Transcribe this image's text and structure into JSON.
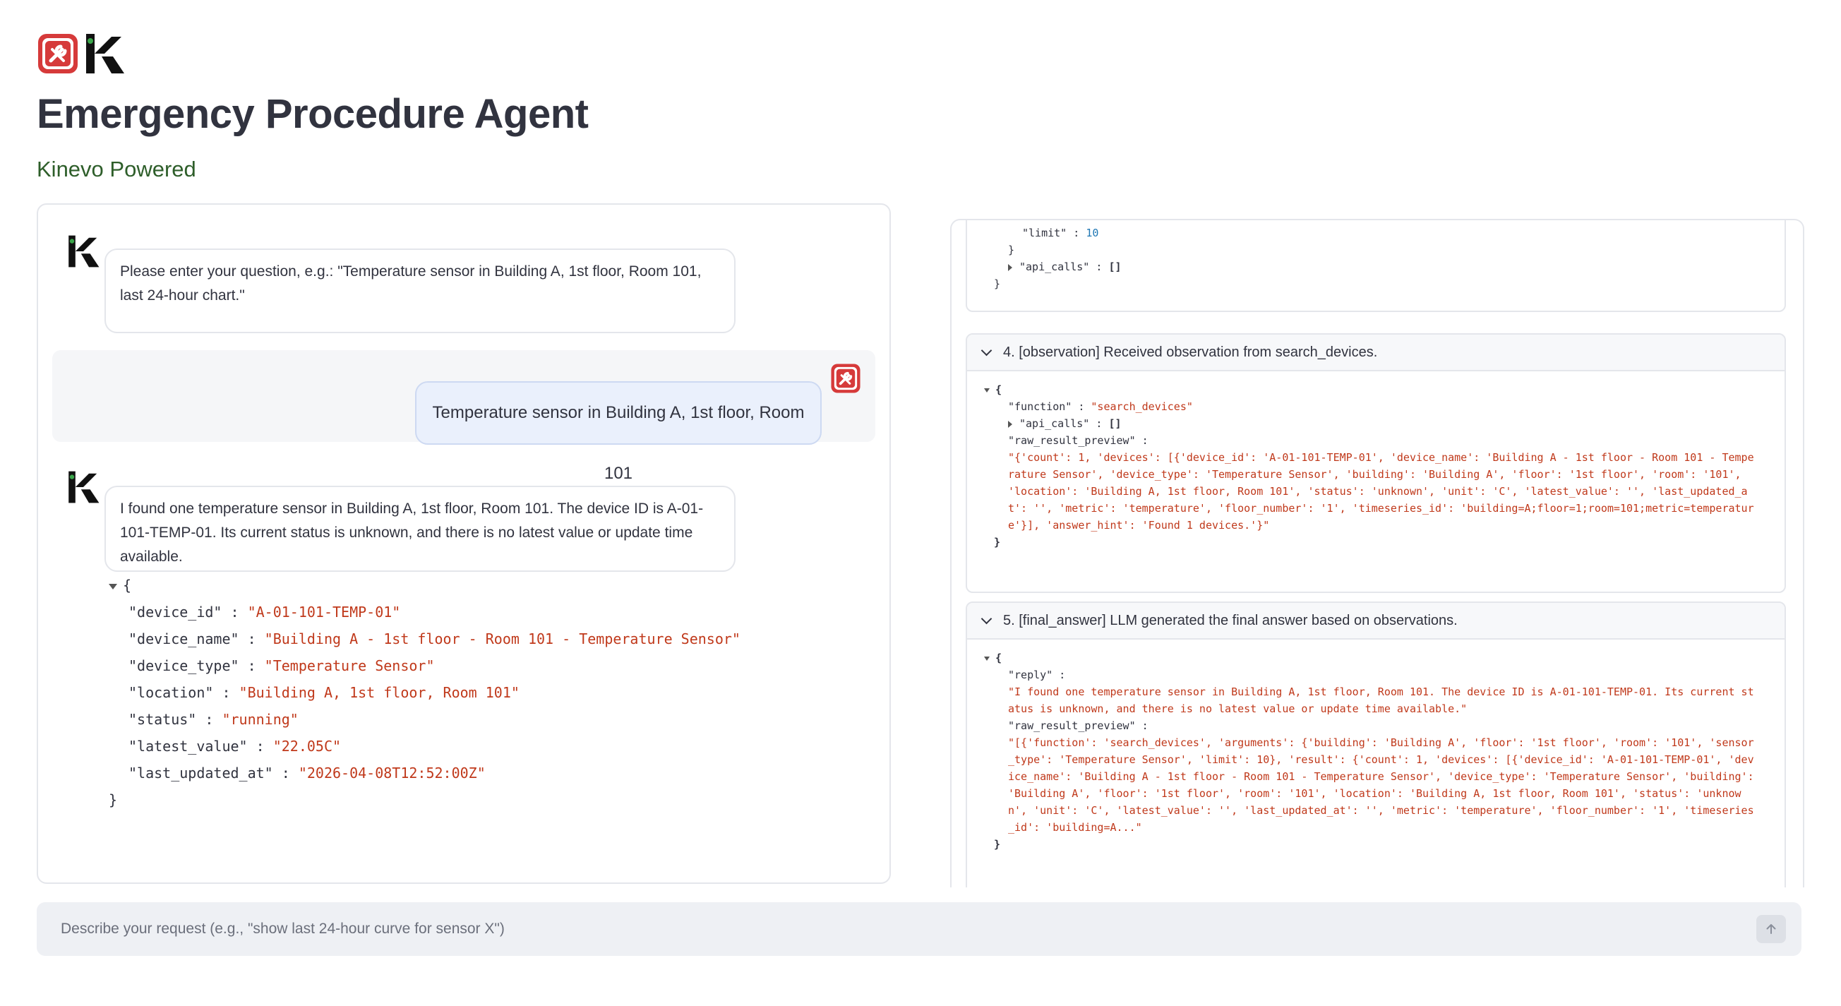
{
  "header": {
    "title": "Emergency Procedure Agent",
    "subtitle": "Kinevo Powered"
  },
  "chat": {
    "assistant_intro": "Please enter your question, e.g.: \"Temperature sensor in Building A, 1st floor, Room 101, last 24-hour chart.\"",
    "user_message": "Temperature sensor in Building A, 1st floor, Room 101",
    "assistant_reply": "I found one temperature sensor in Building A, 1st floor, Room 101. The device ID is A-01-101-TEMP-01. Its current status is unknown, and there is no latest value or update time available.",
    "result_json": [
      {
        "key": "\"device_id\"",
        "value": "\"A-01-101-TEMP-01\""
      },
      {
        "key": "\"device_name\"",
        "value": "\"Building A - 1st floor - Room 101 - Temperature Sensor\""
      },
      {
        "key": "\"device_type\"",
        "value": "\"Temperature Sensor\""
      },
      {
        "key": "\"location\"",
        "value": "\"Building A, 1st floor, Room 101\""
      },
      {
        "key": "\"status\"",
        "value": "\"running\""
      },
      {
        "key": "\"latest_value\"",
        "value": "\"22.05C\""
      },
      {
        "key": "\"last_updated_at\"",
        "value": "\"2026-04-08T12:52:00Z\""
      }
    ]
  },
  "trace": {
    "partial_step": {
      "limit_key": "\"limit\"",
      "limit_value": "10",
      "api_calls_key": "\"api_calls\"",
      "api_calls_value": "[]"
    },
    "step4": {
      "title": "4. [observation] Received observation from search_devices.",
      "function_key": "\"function\"",
      "function_value": "\"search_devices\"",
      "api_calls_key": "\"api_calls\"",
      "api_calls_value": "[]",
      "raw_key": "\"raw_result_preview\"",
      "raw_value": "\"{'count': 1, 'devices': [{'device_id': 'A-01-101-TEMP-01', 'device_name': 'Building A - 1st floor - Room 101 - Temperature Sensor', 'device_type': 'Temperature Sensor', 'building': 'Building A', 'floor': '1st floor', 'room': '101', 'location': 'Building A, 1st floor, Room 101', 'status': 'unknown', 'unit': 'C', 'latest_value': '', 'last_updated_at': '', 'metric': 'temperature', 'floor_number': '1', 'timeseries_id': 'building=A;floor=1;room=101;metric=temperature'}], 'answer_hint': 'Found 1 devices.'}\""
    },
    "step5": {
      "title": "5. [final_answer] LLM generated the final answer based on observations.",
      "reply_key": "\"reply\"",
      "reply_value": "\"I found one temperature sensor in Building A, 1st floor, Room 101. The device ID is A-01-101-TEMP-01. Its current status is unknown, and there is no latest value or update time available.\"",
      "raw_key": "\"raw_result_preview\"",
      "raw_value": "\"[{'function': 'search_devices', 'arguments': {'building': 'Building A', 'floor': '1st floor', 'room': '101', 'sensor_type': 'Temperature Sensor', 'limit': 10}, 'result': {'count': 1, 'devices': [{'device_id': 'A-01-101-TEMP-01', 'device_name': 'Building A - 1st floor - Room 101 - Temperature Sensor', 'device_type': 'Temperature Sensor', 'building': 'Building A', 'floor': '1st floor', 'room': '101', 'location': 'Building A, 1st floor, Room 101', 'status': 'unknown', 'unit': 'C', 'latest_value': '', 'last_updated_at': '', 'metric': 'temperature', 'floor_number': '1', 'timeseries_id': 'building=A...\""
    }
  },
  "input": {
    "placeholder": "Describe your request (e.g., \"show last 24-hour curve for sensor X\")"
  },
  "icons": {
    "user_avatar": "wrench-shield-icon",
    "assistant_avatar": "kinevo-k-icon",
    "send": "arrow-up-icon"
  },
  "colors": {
    "user_avatar_red": "#d63a3a",
    "subtitle_green": "#2e5e2a",
    "json_string": "#c0391b",
    "json_number": "#1f77b4"
  }
}
